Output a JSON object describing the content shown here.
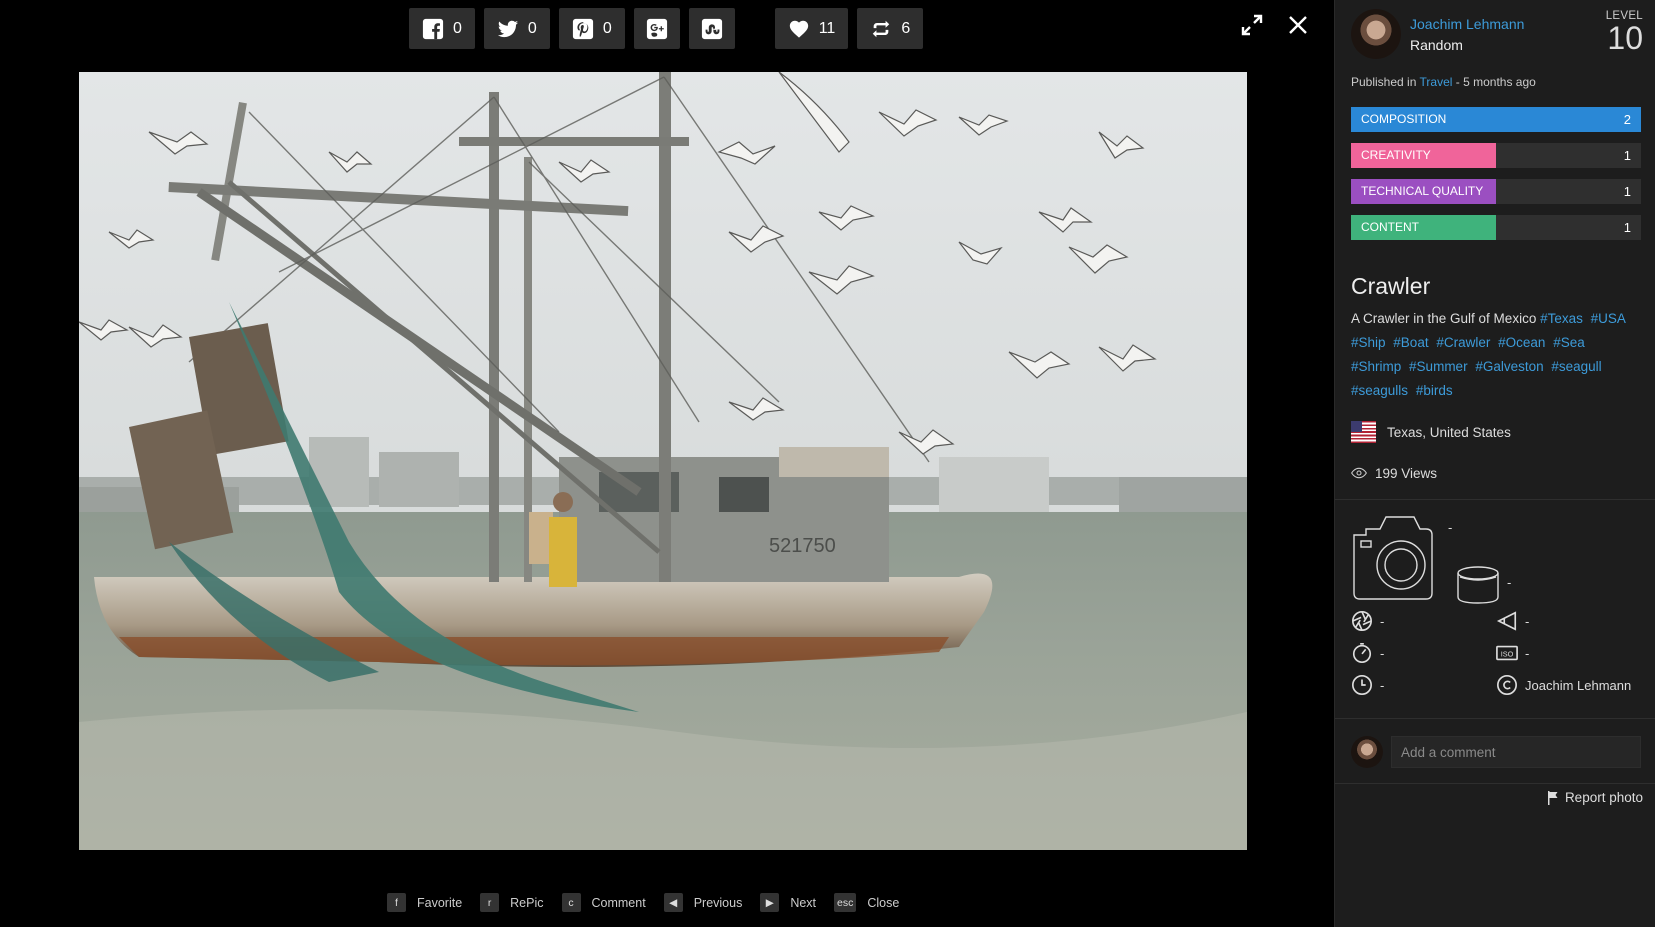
{
  "share": {
    "facebook": "0",
    "twitter": "0",
    "pinterest": "0",
    "likes": "11",
    "repics": "6"
  },
  "photo_alt": "",
  "shortcuts": [
    {
      "key": "f",
      "label": "Favorite"
    },
    {
      "key": "r",
      "label": "RePic"
    },
    {
      "key": "c",
      "label": "Comment"
    },
    {
      "key": "◀",
      "label": "Previous"
    },
    {
      "key": "▶",
      "label": "Next"
    },
    {
      "key": "esc",
      "label": "Close"
    }
  ],
  "author": {
    "name": "Joachim Lehmann",
    "subtitle": "Random",
    "level_label": "LEVEL",
    "level": "10"
  },
  "published": {
    "prefix": "Published in",
    "category": "Travel",
    "suffix": "- 5 months ago"
  },
  "scores": [
    {
      "label": "COMPOSITION",
      "value": "2",
      "fill": 1.0,
      "color": "#2a88d6"
    },
    {
      "label": "CREATIVITY",
      "value": "1",
      "fill": 0.5,
      "color": "#f0649a"
    },
    {
      "label": "TECHNICAL QUALITY",
      "value": "1",
      "fill": 0.5,
      "color": "#9b4fc1"
    },
    {
      "label": "CONTENT",
      "value": "1",
      "fill": 0.5,
      "color": "#3fb37c"
    }
  ],
  "photo": {
    "title": "Crawler",
    "description": "A Crawler in the Gulf of Mexico",
    "tags": [
      "#Texas",
      "#USA",
      "#Ship",
      "#Boat",
      "#Crawler",
      "#Ocean",
      "#Sea",
      "#Shrimp",
      "#Summer",
      "#Galveston",
      "#seagull",
      "#seagulls",
      "#birds"
    ],
    "location": "Texas, United States",
    "views": "199 Views"
  },
  "exif": {
    "camera": "-",
    "lens": "-",
    "aperture": "-",
    "focal": "-",
    "shutter": "-",
    "iso": "-",
    "time": "-",
    "copyright": "Joachim Lehmann"
  },
  "comment": {
    "placeholder": "Add a comment"
  },
  "report": "Report photo"
}
